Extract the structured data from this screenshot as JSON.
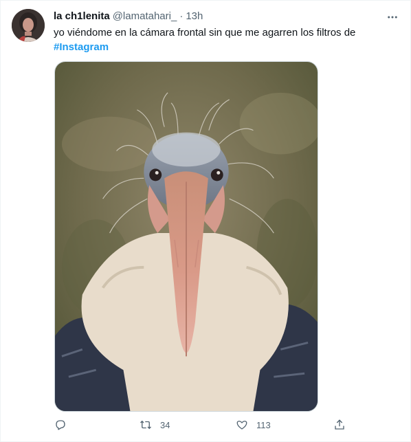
{
  "author": {
    "display_name": "la ch1lenita",
    "handle": "@lamatahari_",
    "separator": "·",
    "time": "13h",
    "avatar_icon": "profile-avatar"
  },
  "tweet": {
    "text": "yo viéndome en la cámara frontal sin que me agarren los filtros de",
    "hashtag": "#Instagram",
    "media_subject": "marabou stork close-up"
  },
  "actions": {
    "reply": {
      "icon": "reply-icon",
      "count": ""
    },
    "retweet": {
      "icon": "retweet-icon",
      "count": "34"
    },
    "like": {
      "icon": "heart-icon",
      "count": "113"
    },
    "share": {
      "icon": "share-icon",
      "count": ""
    }
  },
  "colors": {
    "text_primary": "#0f1419",
    "text_secondary": "#536471",
    "accent": "#1d9bf0",
    "border": "#cfd9de"
  }
}
